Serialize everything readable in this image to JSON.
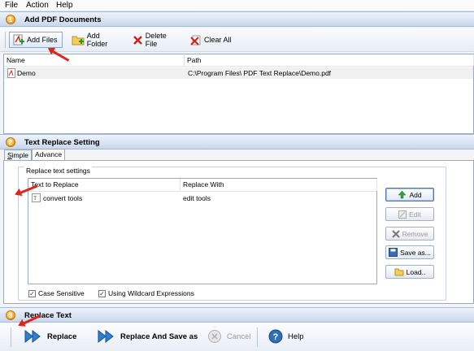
{
  "menu": {
    "file": "File",
    "action": "Action",
    "help": "Help"
  },
  "section1": {
    "number": "1",
    "title": "Add PDF Documents"
  },
  "toolbar1": {
    "add_files": "Add Files",
    "add_folder": "Add Folder",
    "delete_file": "Delete File",
    "clear_all": "Clear All"
  },
  "file_list": {
    "columns": [
      "Name",
      "Path"
    ],
    "rows": [
      {
        "name": "Demo",
        "path": "C:\\Program Files\\   PDF Text Replace\\Demo.pdf"
      }
    ]
  },
  "section2": {
    "number": "2",
    "title": "Text Replace Setting"
  },
  "tabs": {
    "simple": "Simple",
    "advance": "Advance"
  },
  "replace_group": {
    "legend": "Replace text settings",
    "columns": [
      "Text to Replace",
      "Replace With"
    ],
    "rows": [
      {
        "find": "convert tools",
        "replace": "edit tools"
      }
    ],
    "case_sensitive": {
      "label": "Case Sensitive",
      "checked": true
    },
    "wildcard": {
      "label": "Using Wildcard Expressions",
      "checked": true
    }
  },
  "side_buttons": {
    "add": "Add",
    "edit": "Edit",
    "remove": "Remove",
    "save_as": "Save as...",
    "load": "Load.."
  },
  "section3": {
    "number": "3",
    "title": "Replace Text"
  },
  "toolbar3": {
    "replace": "Replace",
    "replace_save": "Replace And Save as",
    "cancel": "Cancel",
    "help": "Help"
  },
  "colors": {
    "accent": "#2f6fb5",
    "annotation_arrow": "#e2231a",
    "header_gradient_bottom": "#c9d7ec"
  }
}
